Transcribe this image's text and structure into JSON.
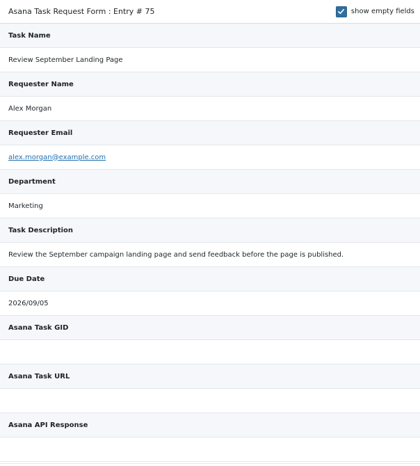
{
  "header": {
    "title": "Asana Task Request Form : Entry # 75",
    "show_empty_label": "show empty fields",
    "show_empty_checked": true
  },
  "fields": [
    {
      "label": "Task Name",
      "value": "Review September Landing Page"
    },
    {
      "label": "Requester Name",
      "value": "Alex Morgan"
    },
    {
      "label": "Requester Email",
      "value": "alex.morgan@example.com"
    },
    {
      "label": "Department",
      "value": "Marketing"
    },
    {
      "label": "Task Description",
      "value": "Review the September campaign landing page and send feedback before the page is published."
    },
    {
      "label": "Due Date",
      "value": "2026/09/05"
    },
    {
      "label": "Asana Task GID",
      "value": ""
    },
    {
      "label": "Asana Task URL",
      "value": ""
    },
    {
      "label": "Asana API Response",
      "value": ""
    }
  ],
  "colors": {
    "accent": "#2f6fa0",
    "link": "#2271b1",
    "label_bg": "#f5f7fa"
  }
}
